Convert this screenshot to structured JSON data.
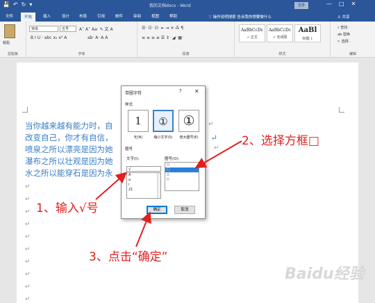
{
  "window": {
    "title": "我的文档docx - Word",
    "login": "登录",
    "quick_access": [
      "💾",
      "↶",
      "↻",
      "▾"
    ],
    "controls": [
      "—",
      "□",
      "✕"
    ]
  },
  "tabs": [
    "文件",
    "开始",
    "插入",
    "设计",
    "布局",
    "引用",
    "邮件",
    "审阅",
    "视图",
    "帮助"
  ],
  "active_tab": "开始",
  "tell_me": "♡ 操作说明搜索   告诉我你想要做什么",
  "share": "♙ 共享",
  "ribbon": {
    "clipboard": {
      "paste": "粘贴",
      "label": "剪贴板"
    },
    "font": {
      "font_name": "宋体",
      "font_size": "五号",
      "row1_icons": "A˄ A˅ Aa· ✎ 文 A",
      "row2_icons": "B I U · abc x₂ x² A",
      "row3_icons": "ab· A· A A",
      "label": "字体"
    },
    "paragraph": {
      "row1_icons": "☰· ☷· ☷· ⇤ ⇥ ✕ ⁂ ¶",
      "row2_icons": "≡ ≡ ≡ ≡ ☰ ↕· ◢· ▦·",
      "label": "段落"
    },
    "styles": {
      "items": [
        {
          "sample": "AaBbCcDc",
          "name": "↵ 正文"
        },
        {
          "sample": "AaBbCcDc",
          "name": "↵ 无间隔"
        },
        {
          "sample": "AaBl",
          "name": "标题 1"
        }
      ],
      "label": "样式"
    },
    "editing": {
      "items": [
        "⌕ 查找 ·",
        "ab 替换",
        "↖ 选择 ·"
      ],
      "label": "编辑"
    }
  },
  "document": {
    "lines": [
      "当你越来越有能力时，自",
      "改变自己，你才有自信，",
      "喷泉之所以漂亮是因为她",
      "瀑布之所以壮观是因为她",
      "水之所以能穿石是因为永"
    ],
    "right_fragment": "。↵",
    "paragraph_mark": "↵"
  },
  "dialog": {
    "title": "带圈字符",
    "help": "?",
    "close": "✕",
    "style_label": "样式",
    "style_options": [
      {
        "glyph": "1",
        "label": "无(N)"
      },
      {
        "glyph": "①",
        "label": "缩小文字(S)"
      },
      {
        "glyph": "①",
        "label": "增大圈号(E)"
      }
    ],
    "circled_label": "圈号",
    "text_label": "文字(I):",
    "text_value": "√",
    "text_list": [
      "√",
      "A",
      "a",
      "i",
      "21"
    ],
    "shape_label": "圈号(O):",
    "shape_list": [
      "○",
      "□",
      "△",
      "◇"
    ],
    "ok": "确定",
    "cancel": "取消"
  },
  "annotations": {
    "step1": "1、输入√号",
    "step2": "2、选择方框□",
    "step3": "3、点击“确定”",
    "color": "#e0201e"
  },
  "watermark": "Baidu经验",
  "colors": {
    "word_blue": "#2b579a",
    "doc_text": "#3a7cc7",
    "selection": "#2b7fd9"
  }
}
